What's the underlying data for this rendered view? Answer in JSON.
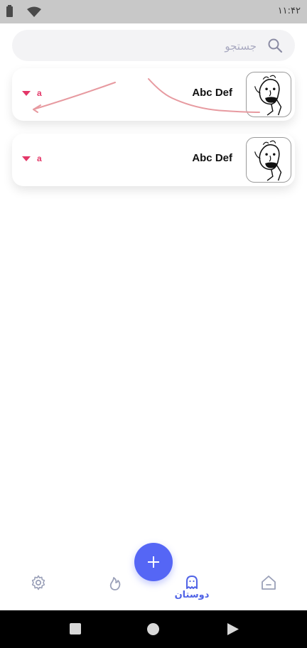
{
  "status_bar": {
    "time": "۱۱:۴۲"
  },
  "search": {
    "placeholder": "جستجو",
    "value": ""
  },
  "friends": [
    {
      "name": "Abc Def",
      "status": "a"
    },
    {
      "name": "Abc Def",
      "status": "a"
    }
  ],
  "bottom_nav": {
    "active_label": "دوستان",
    "items": [
      {
        "icon": "gear-icon"
      },
      {
        "icon": "flame-icon"
      },
      {
        "icon": "ghost-icon",
        "label": "دوستان"
      },
      {
        "icon": "home-icon"
      }
    ]
  },
  "colors": {
    "accent": "#5566f5",
    "status": "#e33768",
    "nav_active": "#5063e6",
    "nav_inactive": "#9aa0b8",
    "search_bg": "#f3f3f5"
  }
}
